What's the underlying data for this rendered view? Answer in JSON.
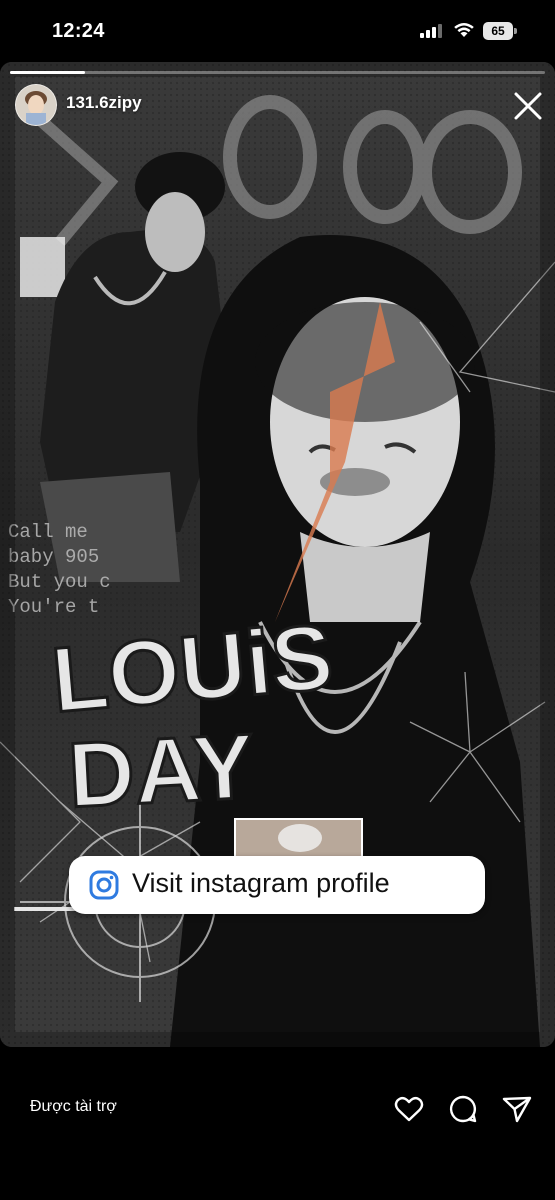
{
  "status_bar": {
    "time": "12:24",
    "battery_percent": "65",
    "icons": [
      "signal-icon",
      "wifi-icon",
      "battery-icon"
    ]
  },
  "story": {
    "progress": 0.14,
    "username": "131.6zipy",
    "close_icon": "close-icon",
    "artwork_text": {
      "title_line1": "LOUiS",
      "title_line2": "DAY",
      "terminal_lines": [
        "Call me",
        "baby 905",
        "But you c",
        "You're t"
      ]
    },
    "cta": {
      "icon": "instagram-icon",
      "label": "Visit instagram profile"
    }
  },
  "bottom_bar": {
    "sponsored_label": "Được tài trợ",
    "actions": [
      "heart-icon",
      "comment-icon",
      "share-icon"
    ]
  },
  "colors": {
    "background": "#000000",
    "accent_orange": "#d97a4f",
    "instagram_blue": "#2f7be0"
  }
}
